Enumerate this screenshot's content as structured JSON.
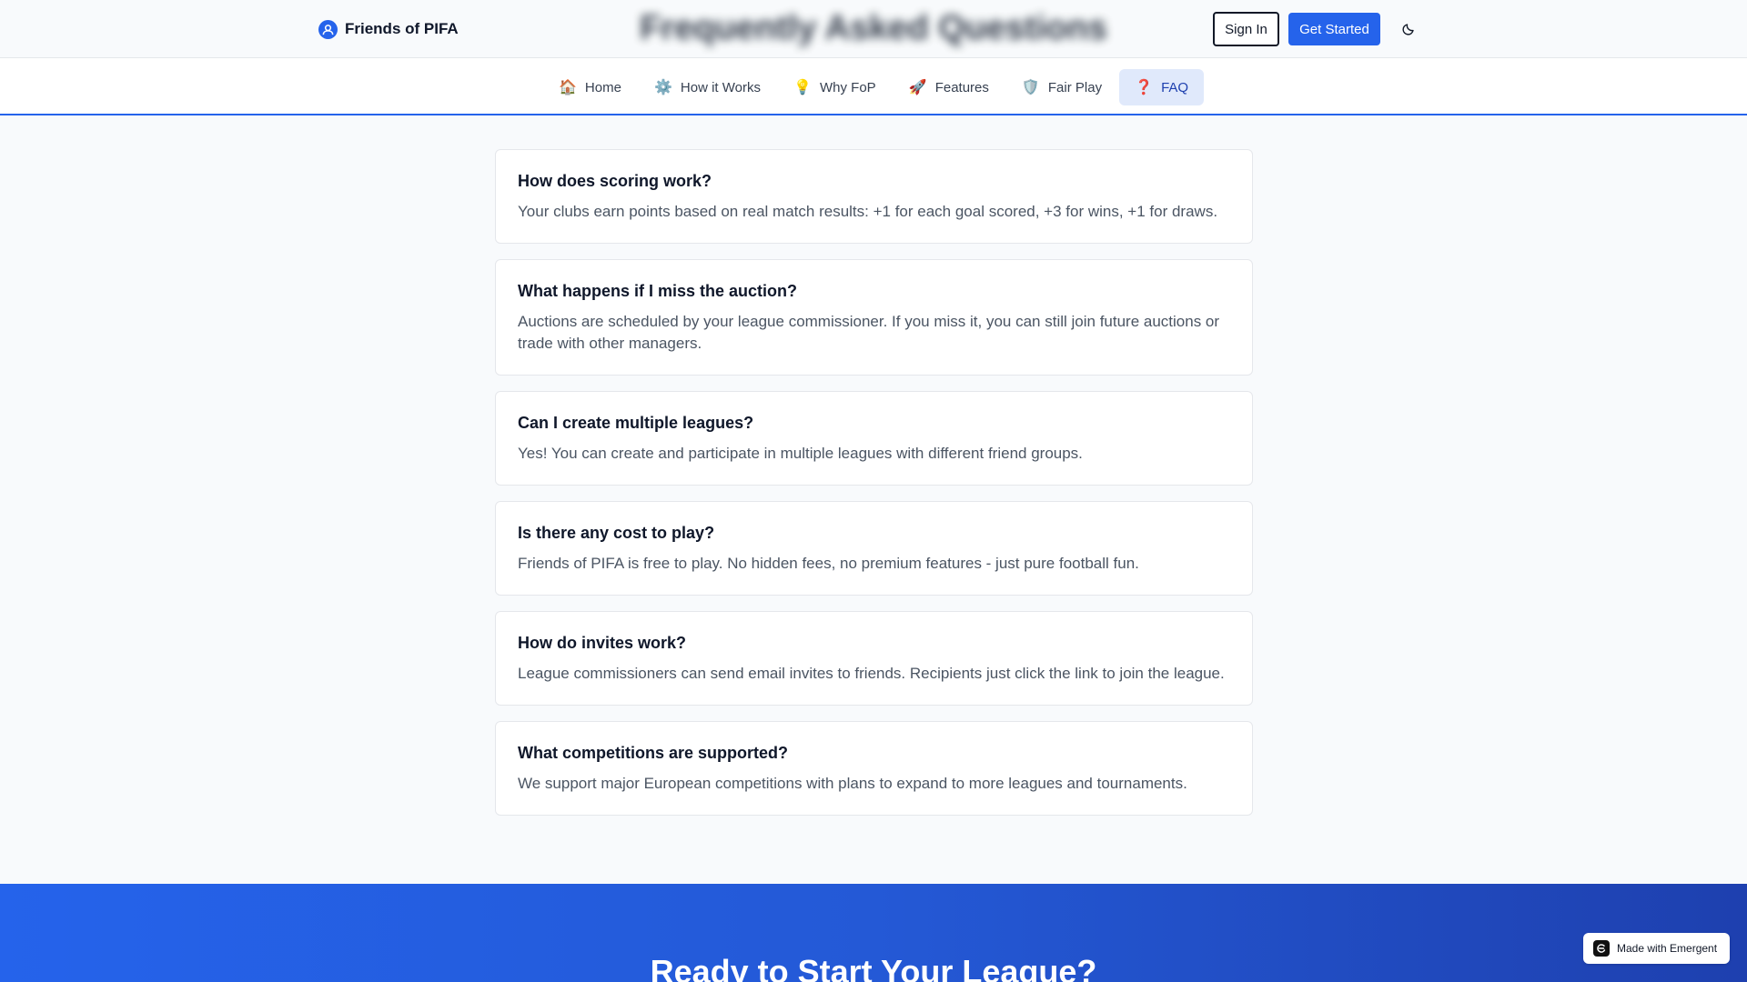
{
  "brand": {
    "name": "Friends of PIFA",
    "logo_icon": "users-icon",
    "accent": "#2563eb"
  },
  "header": {
    "page_title": "Frequently Asked Questions",
    "signin_label": "Sign In",
    "get_started_label": "Get Started",
    "theme_icon": "moon-icon"
  },
  "nav": {
    "items": [
      {
        "icon": "🏠",
        "label": "Home"
      },
      {
        "icon": "⚙️",
        "label": "How it Works"
      },
      {
        "icon": "💡",
        "label": "Why FoP"
      },
      {
        "icon": "🚀",
        "label": "Features"
      },
      {
        "icon": "🛡️",
        "label": "Fair Play"
      },
      {
        "icon": "❓",
        "label": "FAQ"
      }
    ],
    "active": "FAQ"
  },
  "faq": [
    {
      "q": "How does scoring work?",
      "a": "Your clubs earn points based on real match results: +1 for each goal scored, +3 for wins, +1 for draws."
    },
    {
      "q": "What happens if I miss the auction?",
      "a": "Auctions are scheduled by your league commissioner. If you miss it, you can still join future auctions or trade with other managers."
    },
    {
      "q": "Can I create multiple leagues?",
      "a": "Yes! You can create and participate in multiple leagues with different friend groups."
    },
    {
      "q": "Is there any cost to play?",
      "a": "Friends of PIFA is free to play. No hidden fees, no premium features - just pure football fun."
    },
    {
      "q": "How do invites work?",
      "a": "League commissioners can send email invites to friends. Recipients just click the link to join the league."
    },
    {
      "q": "What competitions are supported?",
      "a": "We support major European competitions with plans to expand to more leagues and tournaments."
    }
  ],
  "cta": {
    "title": "Ready to Start Your League?"
  },
  "badge": {
    "label": "Made with Emergent"
  }
}
